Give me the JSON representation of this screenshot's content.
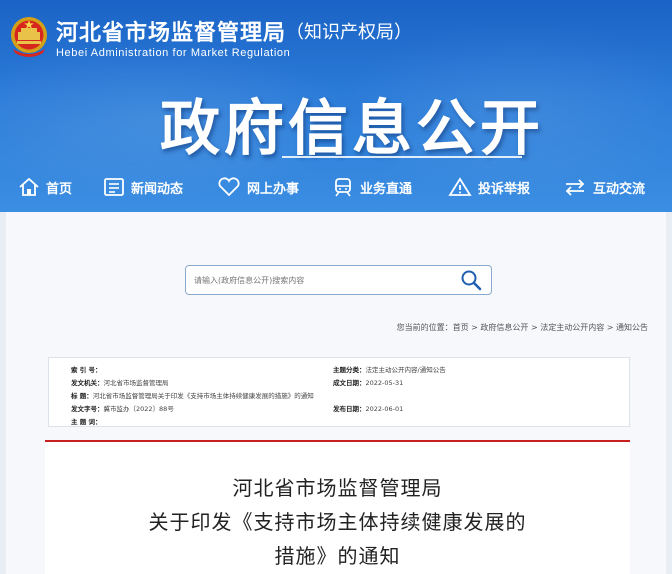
{
  "header": {
    "org_name": "河北省市场监督管理局",
    "org_sub": "（知识产权局）",
    "org_en": "Hebei  Administration  for  Market  Regulation",
    "banner_title": "政府信息公开"
  },
  "nav": {
    "items": [
      {
        "label": "首页",
        "icon": "home-icon"
      },
      {
        "label": "新闻动态",
        "icon": "news-icon"
      },
      {
        "label": "网上办事",
        "icon": "heart-icon"
      },
      {
        "label": "业务直通",
        "icon": "train-icon"
      },
      {
        "label": "投诉举报",
        "icon": "warning-icon"
      },
      {
        "label": "互动交流",
        "icon": "exchange-icon"
      }
    ]
  },
  "search": {
    "placeholder": "请输入(政府信息公开)搜索内容"
  },
  "breadcrumb": "您当前的位置：首页 > 政府信息公开 > 法定主动公开内容 > 通知公告",
  "meta": {
    "index_label": "索  引  号：",
    "index_value": "",
    "issuer_label": "发文机关：",
    "issuer_value": "河北省市场监督管理局",
    "title_label": "标      题：",
    "title_value": "河北省市场监督管理局关于印发《支持市场主体持续健康发展的措施》的通知",
    "docno_label": "发文字号：",
    "docno_value": "冀市监办〔2022〕88号",
    "topic_label": "主  题  词：",
    "topic_value": "",
    "category_label": "主题分类：",
    "category_value": "法定主动公开内容/通知公告",
    "created_label": "成文日期：",
    "created_value": "2022-05-31",
    "published_label": "发布日期：",
    "published_value": "2022-06-01"
  },
  "document": {
    "line1": "河北省市场监督管理局",
    "line2": "关于印发《支持市场主体持续健康发展的",
    "line3": "措施》的通知"
  }
}
